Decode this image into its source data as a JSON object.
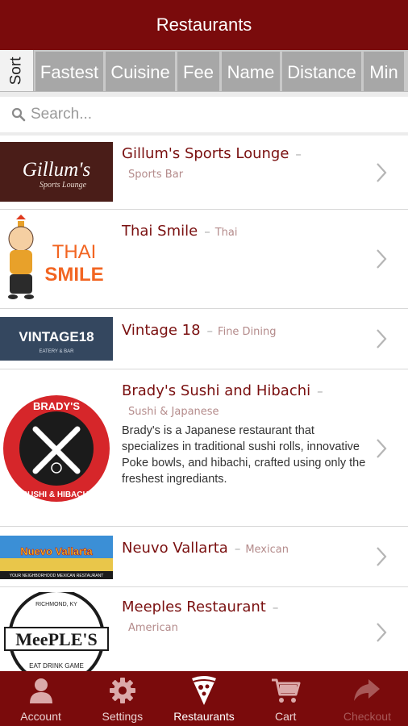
{
  "header": {
    "title": "Restaurants"
  },
  "sort": {
    "label": "Sort",
    "options": [
      "Fastest",
      "Cuisine",
      "Fee",
      "Name",
      "Distance",
      "Min"
    ]
  },
  "search": {
    "placeholder": "Search..."
  },
  "restaurants": [
    {
      "name": "Gillum's Sports Lounge",
      "category": "Sports Bar",
      "logo_text": "Gillum's",
      "logo_sub": "Sports Lounge"
    },
    {
      "name": "Thai Smile",
      "category": "Thai",
      "logo_text": "THAI",
      "logo_sub": "SMILE"
    },
    {
      "name": "Vintage 18",
      "category": "Fine Dining",
      "logo_text": "VINTAGE18",
      "logo_sub": "EATERY & BAR"
    },
    {
      "name": "Brady's Sushi and Hibachi",
      "category": "Sushi & Japanese",
      "description": "Brady's is a Japanese restaurant that specializes in traditional sushi rolls, innovative Poke bowls, and hibachi, crafted using only the freshest ingrediants.",
      "logo_text": "BRADY'S",
      "logo_sub": "SUSHI & HIBACHI"
    },
    {
      "name": "Neuvo Vallarta",
      "category": "Mexican",
      "logo_text": "Nuevo Vallarta",
      "logo_sub": "YOUR NEIGHBORHOOD MEXICAN RESTAURANT"
    },
    {
      "name": "Meeples Restaurant",
      "category": "American",
      "logo_text": "MeePLE'S",
      "logo_sub": "EAT DRINK GAME",
      "logo_top": "RICHMOND, KY"
    }
  ],
  "tabs": [
    {
      "label": "Account",
      "icon": "person-icon"
    },
    {
      "label": "Settings",
      "icon": "gear-icon"
    },
    {
      "label": "Restaurants",
      "icon": "pizza-icon"
    },
    {
      "label": "Cart",
      "icon": "cart-icon"
    },
    {
      "label": "Checkout",
      "icon": "share-arrow-icon"
    }
  ],
  "colors": {
    "brand": "#7a0b0c",
    "sort_tab": "#a7a7a7",
    "name_text": "#7a1010",
    "category_text": "#b48b8b"
  }
}
